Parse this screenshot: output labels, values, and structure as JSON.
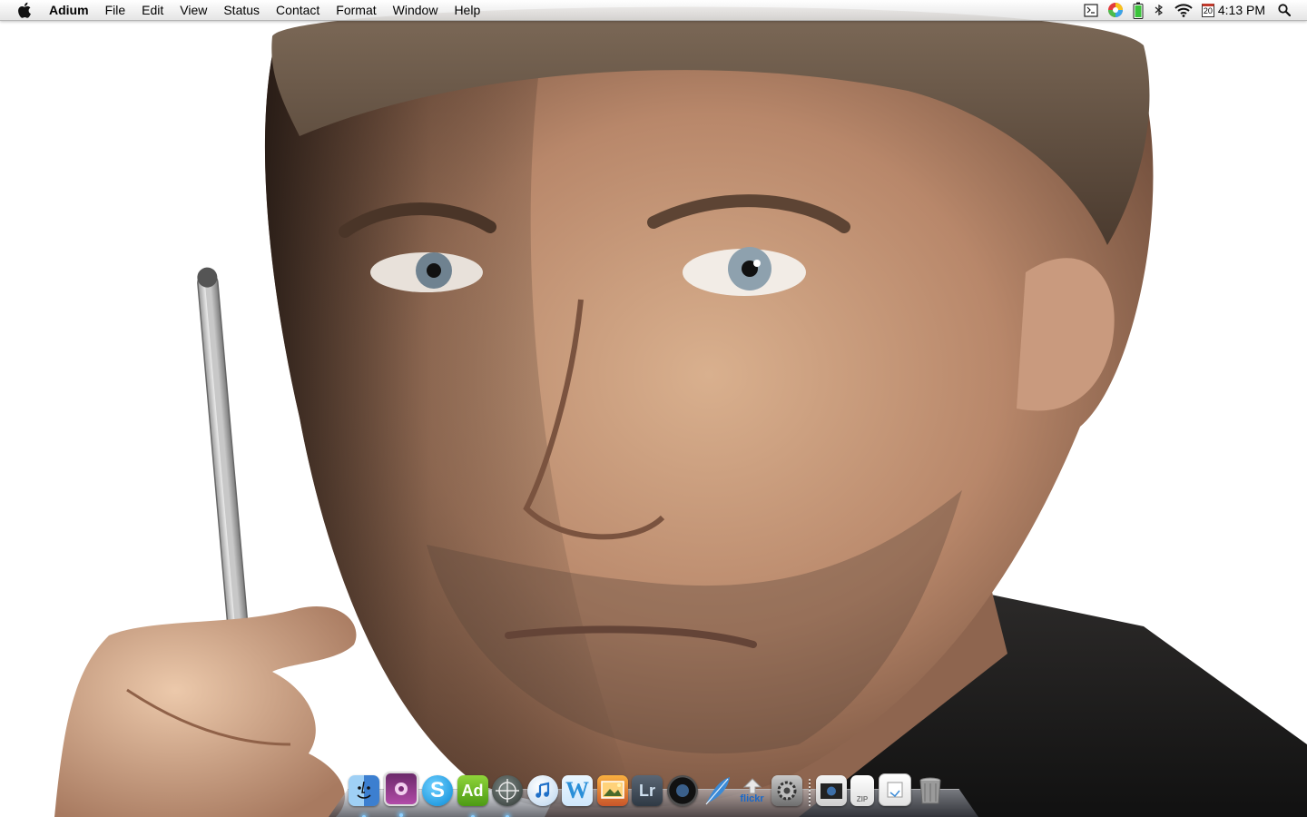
{
  "menubar": {
    "apple_icon": "apple-logo-icon",
    "app_name": "Adium",
    "menus": [
      "File",
      "Edit",
      "View",
      "Status",
      "Contact",
      "Format",
      "Window",
      "Help"
    ],
    "status_icons": [
      "script-editor-icon",
      "color-picker-icon",
      "battery-icon",
      "bluetooth-icon",
      "wifi-icon",
      "calendar-icon"
    ],
    "calendar_day": "20",
    "clock": "4:13 PM",
    "spotlight_icon": "spotlight-search-icon"
  },
  "dock": {
    "apps": [
      {
        "name": "Finder",
        "icon": "finder-icon",
        "running": true
      },
      {
        "name": "Photo Booth",
        "icon": "photo-booth-icon",
        "running": true
      },
      {
        "name": "Skype",
        "icon": "skype-icon",
        "running": false
      },
      {
        "name": "Adium",
        "label": "Ad",
        "icon": "adium-icon",
        "running": true
      },
      {
        "name": "Network Utility",
        "icon": "crosshair-icon",
        "running": true
      },
      {
        "name": "iTunes",
        "icon": "itunes-icon",
        "running": false
      },
      {
        "name": "Wunderlist",
        "icon": "w-icon",
        "running": false
      },
      {
        "name": "iPhoto",
        "icon": "iphoto-icon",
        "running": false
      },
      {
        "name": "Lightroom",
        "label": "Lr",
        "icon": "lightroom-icon",
        "running": false
      },
      {
        "name": "Aperture",
        "icon": "aperture-lens-icon",
        "running": false
      },
      {
        "name": "Feather",
        "icon": "feather-icon",
        "running": false
      },
      {
        "name": "Flickr Uploadr",
        "label": "flickr",
        "icon": "flickr-upload-icon",
        "running": false
      },
      {
        "name": "System Preferences",
        "icon": "system-preferences-icon",
        "running": false
      }
    ],
    "stacks": [
      {
        "name": "Screenshots",
        "icon": "screenshot-folder-icon"
      },
      {
        "name": "Archive",
        "label": "ZIP",
        "icon": "zip-file-icon"
      },
      {
        "name": "Documents",
        "icon": "documents-stack-icon"
      },
      {
        "name": "Trash",
        "icon": "trash-icon"
      }
    ]
  },
  "colors": {
    "menubar_bg": "#ececec",
    "wallpaper_bg": "#ffffff",
    "run_indicator": "#8fd0ff"
  }
}
